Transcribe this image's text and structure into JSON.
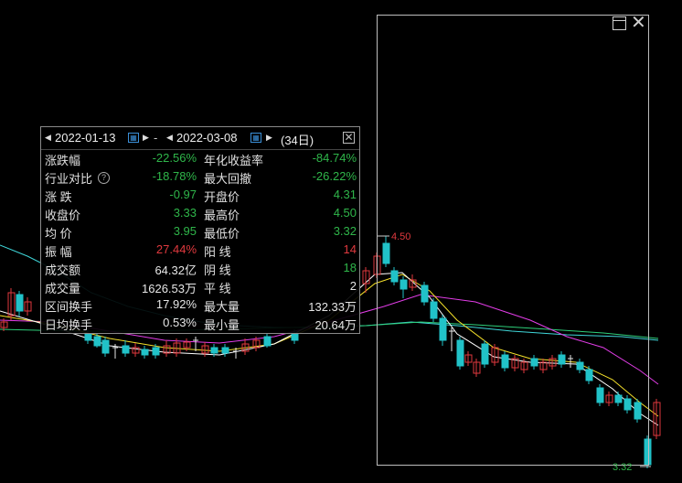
{
  "range": {
    "start": "2022-01-13",
    "separator": "-",
    "end": "2022-03-08",
    "days": "(34日)"
  },
  "price_labels": {
    "high": "4.50",
    "low": "3.32"
  },
  "stats": [
    [
      {
        "label": "涨跌幅",
        "value": "-22.56%",
        "color": "green"
      },
      {
        "label": "年化收益率",
        "value": "-84.74%",
        "color": "green"
      }
    ],
    [
      {
        "label": "行业对比",
        "value": "-18.78%",
        "color": "green",
        "help": true
      },
      {
        "label": "最大回撤",
        "value": "-26.22%",
        "color": "green"
      }
    ],
    [
      {
        "label": "涨  跌",
        "value": "-0.97",
        "color": "green"
      },
      {
        "label": "开盘价",
        "value": "4.31",
        "color": "green"
      }
    ],
    [
      {
        "label": "收盘价",
        "value": "3.33",
        "color": "green"
      },
      {
        "label": "最高价",
        "value": "4.50",
        "color": "green"
      }
    ],
    [
      {
        "label": "均  价",
        "value": "3.95",
        "color": "green"
      },
      {
        "label": "最低价",
        "value": "3.32",
        "color": "green"
      }
    ],
    [
      {
        "label": "振  幅",
        "value": "27.44%",
        "color": "red"
      },
      {
        "label": "阳  线",
        "value": "14",
        "color": "red"
      }
    ],
    [
      {
        "label": "成交额",
        "value": "64.32亿",
        "color": "white"
      },
      {
        "label": "阴  线",
        "value": "18",
        "color": "green"
      }
    ],
    [
      {
        "label": "成交量",
        "value": "1626.53万",
        "color": "white"
      },
      {
        "label": "平  线",
        "value": "2",
        "color": "white"
      }
    ],
    [
      {
        "label": "区间换手",
        "value": "17.92%",
        "color": "white"
      },
      {
        "label": "最大量",
        "value": "132.33万",
        "color": "white"
      }
    ],
    [
      {
        "label": "日均换手",
        "value": "0.53%",
        "color": "white"
      },
      {
        "label": "最小量",
        "value": "20.64万",
        "color": "white"
      }
    ]
  ],
  "colors": {
    "up": "#e0393e",
    "down": "#21c2c8",
    "flat": "#e6e6e6",
    "ma5": "#ffffff",
    "ma10": "#f5e12a",
    "ma20": "#e33de8",
    "ma60": "#2ecf7a",
    "ma_cyan": "#3fd6d9"
  }
}
